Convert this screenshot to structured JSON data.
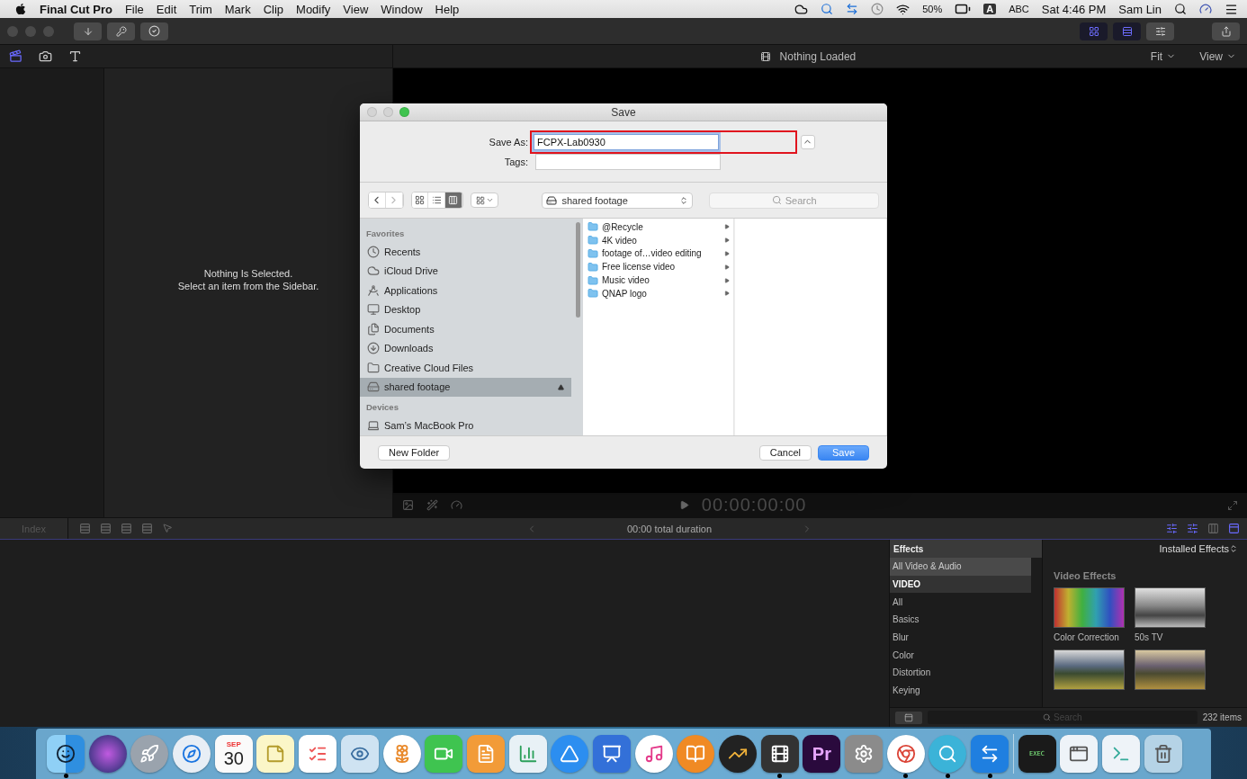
{
  "menu_bar": {
    "app_name": "Final Cut Pro",
    "menus": [
      "File",
      "Edit",
      "Trim",
      "Mark",
      "Clip",
      "Modify",
      "View",
      "Window",
      "Help"
    ],
    "battery": "50%",
    "input_source": "A",
    "input_label": "ABC",
    "clock": "Sat 4:46 PM",
    "user": "Sam Lin"
  },
  "toolbar": {
    "view_buttons": [
      {
        "kind": "grid",
        "selected": true
      },
      {
        "kind": "strip",
        "selected": true
      },
      {
        "kind": "sliders",
        "selected": false
      }
    ]
  },
  "browser": {
    "message": "Nothing Is Selected.",
    "hint": "Select an item from the Sidebar."
  },
  "viewer": {
    "status": "Nothing Loaded",
    "zoom": "Fit",
    "view": "View",
    "timecode": "00:00:00:00"
  },
  "timeline_bar": {
    "index": "Index",
    "duration": "00:00 total duration"
  },
  "effects": {
    "title": "Effects",
    "categories": [
      {
        "label": "All Video & Audio",
        "kind": "item",
        "selected": true
      },
      {
        "label": "VIDEO",
        "kind": "heading",
        "selected": false
      },
      {
        "label": "All",
        "kind": "item",
        "selected": false
      },
      {
        "label": "Basics",
        "kind": "item",
        "selected": false
      },
      {
        "label": "Blur",
        "kind": "item",
        "selected": false
      },
      {
        "label": "Color",
        "kind": "item",
        "selected": false
      },
      {
        "label": "Distortion",
        "kind": "item",
        "selected": false
      },
      {
        "label": "Keying",
        "kind": "item",
        "selected": false
      }
    ],
    "source": "Installed Effects",
    "section": "Video Effects",
    "thumbnails": [
      {
        "label": "Color Correction",
        "kind": "spectrum"
      },
      {
        "label": "50s TV",
        "kind": "mono"
      },
      {
        "kind": "color"
      },
      {
        "kind": "warm"
      }
    ],
    "search": {
      "placeholder": "Search"
    },
    "count": "232 items"
  },
  "dialog": {
    "title": "Save",
    "save_as": {
      "label": "Save As:",
      "value": "FCPX-Lab0930",
      "highlighted": true
    },
    "tags": {
      "label": "Tags:"
    },
    "view_modes": [
      {
        "kind": "icons",
        "selected": false
      },
      {
        "kind": "list",
        "selected": false
      },
      {
        "kind": "columns",
        "selected": true
      }
    ],
    "location": "shared footage",
    "search": {
      "placeholder": "Search"
    },
    "sidebar": [
      {
        "label": "Favorites",
        "kind": "header",
        "selected": false
      },
      {
        "label": "Recents",
        "kind": "recents",
        "selected": false
      },
      {
        "label": "iCloud Drive",
        "kind": "cloud",
        "selected": false
      },
      {
        "label": "Applications",
        "kind": "apps",
        "selected": false
      },
      {
        "label": "Desktop",
        "kind": "desktop",
        "selected": false
      },
      {
        "label": "Documents",
        "kind": "documents",
        "selected": false
      },
      {
        "label": "Downloads",
        "kind": "downloads",
        "selected": false
      },
      {
        "label": "Creative Cloud Files",
        "kind": "folder",
        "selected": false
      },
      {
        "label": "shared footage",
        "kind": "drive",
        "selected": true
      },
      {
        "label": "Devices",
        "kind": "header",
        "selected": false
      },
      {
        "label": "Sam’s MacBook Pro",
        "kind": "laptop",
        "selected": false
      }
    ],
    "files": [
      "@Recycle",
      "4K video",
      "footage of…video editing",
      "Free license video",
      "Music video",
      "QNAP logo"
    ],
    "buttons": {
      "new_folder": "New Folder",
      "cancel": "Cancel",
      "save": "Save"
    }
  },
  "dock": [
    {
      "kind": "finder",
      "running": true
    },
    {
      "kind": "siri",
      "running": false
    },
    {
      "kind": "launchpad",
      "running": false
    },
    {
      "kind": "safari",
      "running": false
    },
    {
      "kind": "calendar",
      "month": "SEP",
      "day": "30",
      "running": false
    },
    {
      "kind": "notes",
      "running": false
    },
    {
      "kind": "reminders",
      "running": false
    },
    {
      "kind": "preview",
      "running": false
    },
    {
      "kind": "photos",
      "running": false
    },
    {
      "kind": "facetime",
      "running": false
    },
    {
      "kind": "pages",
      "running": false
    },
    {
      "kind": "numbers",
      "running": false
    },
    {
      "kind": "appstore",
      "running": false
    },
    {
      "kind": "keynote",
      "running": false
    },
    {
      "kind": "music",
      "running": false
    },
    {
      "kind": "books",
      "running": false
    },
    {
      "kind": "stocks",
      "running": false
    },
    {
      "kind": "finalcut",
      "running": true
    },
    {
      "kind": "premiere",
      "text": "Pr",
      "running": false
    },
    {
      "kind": "settings",
      "running": false
    },
    {
      "kind": "chrome",
      "running": true
    },
    {
      "kind": "magnifier",
      "running": true
    },
    {
      "kind": "remote",
      "running": true
    },
    {
      "kind": "divider"
    },
    {
      "kind": "terminal",
      "text": "EXEC",
      "running": false
    },
    {
      "kind": "window",
      "running": false
    },
    {
      "kind": "window2",
      "running": false
    },
    {
      "kind": "trash",
      "running": false
    }
  ]
}
